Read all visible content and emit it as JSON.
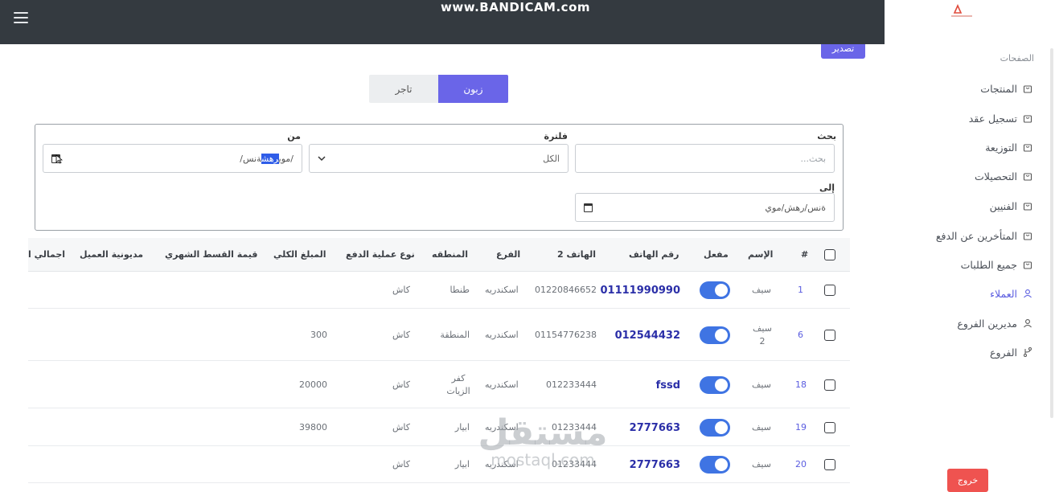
{
  "watermark_top": "www.BANDICAM.com",
  "watermark_bottom": {
    "ar": "مستقل",
    "en": "mostaql.com"
  },
  "export_button": "تصدير",
  "sidebar": {
    "section_label": "الصفحات",
    "items": [
      {
        "label": "المنتجات",
        "icon": "bag-icon"
      },
      {
        "label": "تسجيل عقد",
        "icon": "bag-icon"
      },
      {
        "label": "التوزيعة",
        "icon": "bag-icon"
      },
      {
        "label": "التحصيلات",
        "icon": "bag-icon"
      },
      {
        "label": "الفنيين",
        "icon": "bag-icon"
      },
      {
        "label": "المتأخرين عن الدفع",
        "icon": "bag-icon"
      },
      {
        "label": "جميع الطلبات",
        "icon": "bag-icon"
      },
      {
        "label": "العملاء",
        "icon": "user-icon",
        "active": true
      },
      {
        "label": "مديرين الفروع",
        "icon": "user-icon"
      },
      {
        "label": "الفروع",
        "icon": "branch-icon"
      }
    ],
    "logout": "خروج"
  },
  "tabs": {
    "customer": "زبون",
    "merchant": "تاجر",
    "active": "customer"
  },
  "filters": {
    "search_label": "بحث",
    "search_placeholder": "بحث...",
    "filter_label": "فلترة",
    "filter_value": "الكل",
    "from_label": "من",
    "from_value_pre": "/موي",
    "from_value_sel": "رهش",
    "from_value_post": "ةنس/",
    "to_label": "إلى",
    "to_value": "ةنس/رهش/موي"
  },
  "table": {
    "headers": {
      "index": "#",
      "name": "الإسم",
      "active": "مفعل",
      "phone": "رقم الهاتف",
      "phone2": "الهاتف 2",
      "branch": "الفرع",
      "region": "المنطقه",
      "payment_type": "نوع عملية الدفع",
      "total": "المبلغ الكلي",
      "installment": "قيمة القسط الشهري",
      "debt": "مديونية العميل",
      "grand_total": "اجمالي ا"
    },
    "rows": [
      {
        "index": "1",
        "name": "سيف",
        "name2": "",
        "phone": "01111990990",
        "phone2": "01220846652",
        "branch": "اسكندريه",
        "region": "طنطا",
        "region2": "",
        "payment": "كاش",
        "total": ""
      },
      {
        "index": "6",
        "name": "سيف",
        "name2": "2",
        "phone": "012544432",
        "phone2": "01154776238",
        "branch": "اسكندريه",
        "region": "المنطقة",
        "region2": "",
        "payment": "كاش",
        "total": "300"
      },
      {
        "index": "18",
        "name": "سيف",
        "name2": "",
        "phone": "fssd",
        "phone2": "012233444",
        "branch": "اسكندريه",
        "region": "كفر",
        "region2": "الزيات",
        "payment": "كاش",
        "total": "20000"
      },
      {
        "index": "19",
        "name": "سيف",
        "name2": "",
        "phone": "2777663",
        "phone2": "01233444",
        "branch": "اسكندريه",
        "region": "ابيار",
        "region2": "",
        "payment": "كاش",
        "total": "39800"
      },
      {
        "index": "20",
        "name": "سيف",
        "name2": "",
        "phone": "2777663",
        "phone2": "01233444",
        "branch": "اسكندريه",
        "region": "ابيار",
        "region2": "",
        "payment": "كاش",
        "total": ""
      }
    ]
  },
  "colors": {
    "accent": "#6a65e8",
    "topbar": "#343a40",
    "switch": "#3f74e3",
    "logout": "#ef5350",
    "phone": "#2b2fa8"
  }
}
